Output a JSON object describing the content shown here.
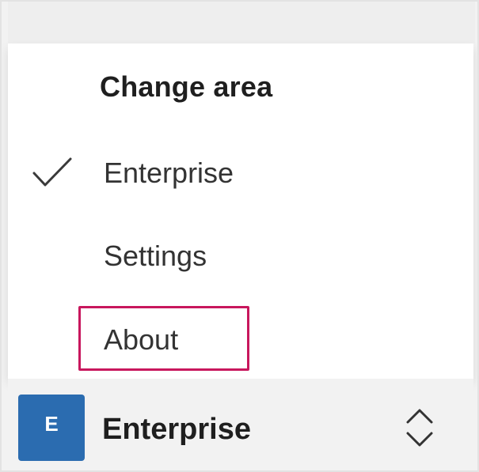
{
  "menu": {
    "heading": "Change area",
    "items": [
      {
        "label": "Enterprise",
        "checked": true
      },
      {
        "label": "Settings",
        "checked": false
      },
      {
        "label": "About",
        "checked": false,
        "highlighted": true
      }
    ]
  },
  "area_switcher": {
    "avatar_letter": "E",
    "avatar_color": "#2b6cb0",
    "current_area": "Enterprise",
    "icon": "chevron-up-down-icon"
  },
  "colors": {
    "highlight": "#c8175d",
    "menu_background": "#ffffff",
    "bar_background": "#f2f2f2"
  }
}
